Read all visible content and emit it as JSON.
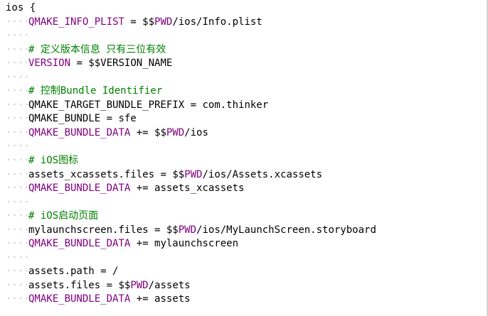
{
  "lines": [
    {
      "indent": false,
      "parts": [
        {
          "t": "ios {",
          "c": "txt"
        }
      ]
    },
    {
      "indent": true,
      "parts": [
        {
          "t": "QMAKE_INFO_PLIST",
          "c": "kw"
        },
        {
          "t": " = ",
          "c": "op"
        },
        {
          "t": "$$",
          "c": "txt"
        },
        {
          "t": "PWD",
          "c": "kw"
        },
        {
          "t": "/ios/Info.plist",
          "c": "txt"
        }
      ]
    },
    {
      "indent": true,
      "parts": []
    },
    {
      "indent": true,
      "parts": [
        {
          "t": "# 定义版本信息 只有三位有效",
          "c": "cm"
        }
      ]
    },
    {
      "indent": true,
      "parts": [
        {
          "t": "VERSION",
          "c": "kw"
        },
        {
          "t": " = ",
          "c": "op"
        },
        {
          "t": "$$VERSION_NAME",
          "c": "txt"
        }
      ]
    },
    {
      "indent": true,
      "parts": []
    },
    {
      "indent": true,
      "parts": [
        {
          "t": "# 控制Bundle Identifier",
          "c": "cm"
        }
      ]
    },
    {
      "indent": true,
      "parts": [
        {
          "t": "QMAKE_TARGET_BUNDLE_PREFIX",
          "c": "txt"
        },
        {
          "t": " = ",
          "c": "op"
        },
        {
          "t": "com.thinker",
          "c": "txt"
        }
      ]
    },
    {
      "indent": true,
      "parts": [
        {
          "t": "QMAKE_BUNDLE",
          "c": "txt"
        },
        {
          "t": " = ",
          "c": "op"
        },
        {
          "t": "sfe",
          "c": "txt"
        }
      ]
    },
    {
      "indent": true,
      "parts": [
        {
          "t": "QMAKE_BUNDLE_DATA",
          "c": "kw"
        },
        {
          "t": " += ",
          "c": "op"
        },
        {
          "t": "$$",
          "c": "txt"
        },
        {
          "t": "PWD",
          "c": "kw"
        },
        {
          "t": "/ios",
          "c": "txt"
        }
      ]
    },
    {
      "indent": true,
      "parts": []
    },
    {
      "indent": true,
      "parts": [
        {
          "t": "# iOS图标",
          "c": "cm"
        }
      ]
    },
    {
      "indent": true,
      "parts": [
        {
          "t": "assets_xcassets.files",
          "c": "txt"
        },
        {
          "t": " = ",
          "c": "op"
        },
        {
          "t": "$$",
          "c": "txt"
        },
        {
          "t": "PWD",
          "c": "kw"
        },
        {
          "t": "/ios/Assets.xcassets",
          "c": "txt"
        }
      ]
    },
    {
      "indent": true,
      "parts": [
        {
          "t": "QMAKE_BUNDLE_DATA",
          "c": "kw"
        },
        {
          "t": " += ",
          "c": "op"
        },
        {
          "t": "assets_xcassets",
          "c": "txt"
        }
      ]
    },
    {
      "indent": true,
      "parts": []
    },
    {
      "indent": true,
      "parts": [
        {
          "t": "# iOS启动页面",
          "c": "cm"
        }
      ]
    },
    {
      "indent": true,
      "parts": [
        {
          "t": "mylaunchscreen.files",
          "c": "txt"
        },
        {
          "t": " = ",
          "c": "op"
        },
        {
          "t": "$$",
          "c": "txt"
        },
        {
          "t": "PWD",
          "c": "kw"
        },
        {
          "t": "/ios/MyLaunchScreen.storyboard",
          "c": "txt"
        }
      ]
    },
    {
      "indent": true,
      "parts": [
        {
          "t": "QMAKE_BUNDLE_DATA",
          "c": "kw"
        },
        {
          "t": " += ",
          "c": "op"
        },
        {
          "t": "mylaunchscreen",
          "c": "txt"
        }
      ]
    },
    {
      "indent": true,
      "parts": []
    },
    {
      "indent": true,
      "parts": [
        {
          "t": "assets.path",
          "c": "txt"
        },
        {
          "t": " = ",
          "c": "op"
        },
        {
          "t": "/",
          "c": "txt"
        }
      ]
    },
    {
      "indent": true,
      "parts": [
        {
          "t": "assets.files",
          "c": "txt"
        },
        {
          "t": " = ",
          "c": "op"
        },
        {
          "t": "$$",
          "c": "txt"
        },
        {
          "t": "PWD",
          "c": "kw"
        },
        {
          "t": "/assets",
          "c": "txt"
        }
      ]
    },
    {
      "indent": true,
      "parts": [
        {
          "t": "QMAKE_BUNDLE_DATA",
          "c": "kw"
        },
        {
          "t": " += ",
          "c": "op"
        },
        {
          "t": "assets",
          "c": "txt"
        }
      ]
    }
  ],
  "colors": {
    "keyword": "#800080",
    "comment": "#008000",
    "text": "#000000",
    "whitespace": "#c9c9c9",
    "background": "#ffffff"
  }
}
